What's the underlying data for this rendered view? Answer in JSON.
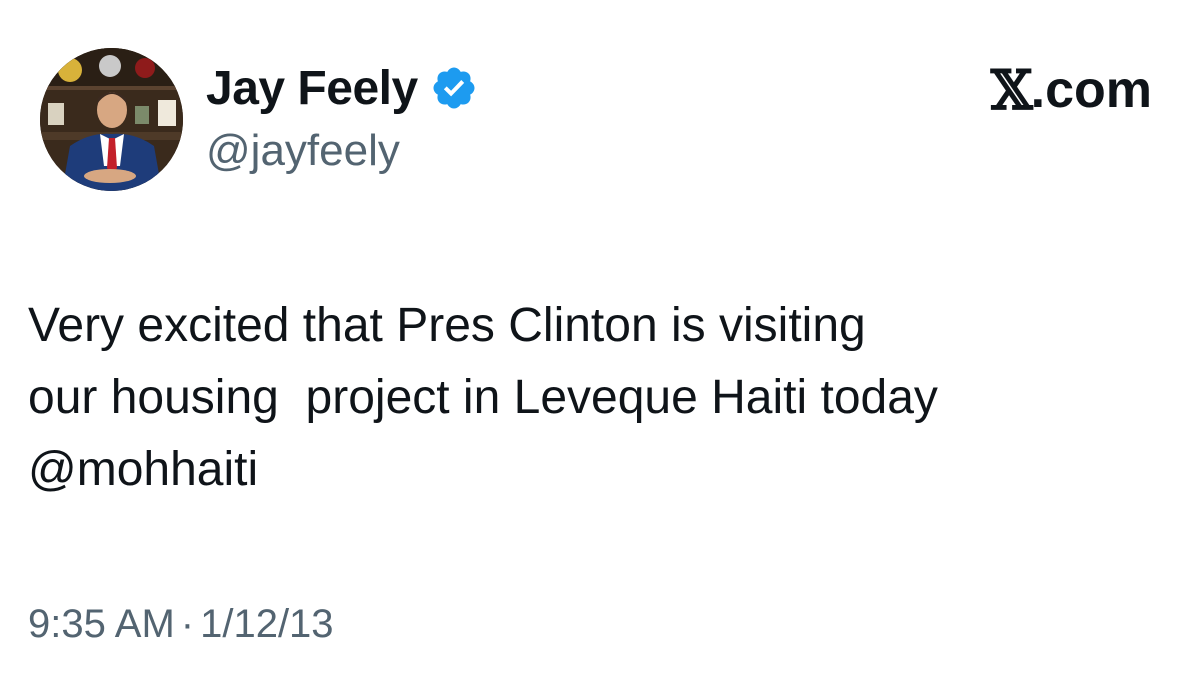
{
  "author": {
    "display_name": "Jay Feely",
    "handle": "@jayfeely",
    "verified": true,
    "verified_icon": "verified-badge-icon",
    "verified_color": "#1d9bf0"
  },
  "brand": {
    "logo": "x-logo-icon",
    "logo_glyph": "𝕏",
    "domain": ".com"
  },
  "tweet": {
    "lines": [
      "Very excited that Pres Clinton is visiting",
      "our housing  project in Leveque Haiti today",
      "@mohhaiti"
    ]
  },
  "meta": {
    "time": "9:35 AM",
    "separator": "·",
    "date": "1/12/13"
  },
  "colors": {
    "text_primary": "#0f1419",
    "text_secondary": "#536471",
    "background": "#ffffff"
  }
}
